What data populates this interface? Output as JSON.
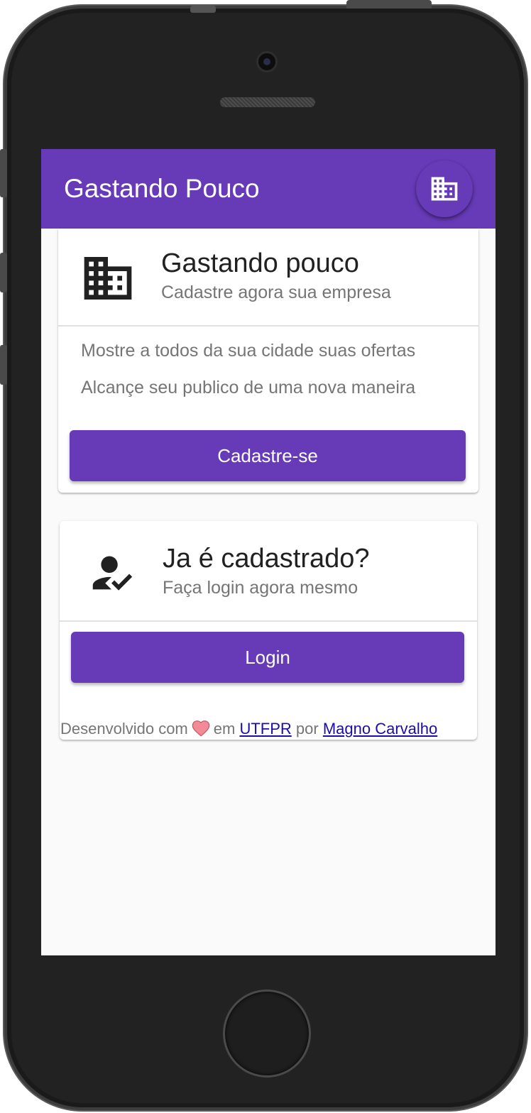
{
  "app": {
    "title": "Gastando Pouco"
  },
  "fab": {
    "icon": "business-icon"
  },
  "register_card": {
    "icon": "business-icon",
    "title": "Gastando pouco",
    "subtitle": "Cadastre agora sua empresa",
    "lines": [
      "Mostre a todos da sua cidade suas ofertas",
      "Alcançe seu publico de uma nova maneira"
    ],
    "button_label": "Cadastre-se"
  },
  "login_card": {
    "icon": "how-to-reg-icon",
    "title": "Ja é cadastrado?",
    "subtitle": "Faça login agora mesmo",
    "button_label": "Login"
  },
  "footer": {
    "prefix": "Desenvolvido com",
    "heart_icon": "heart-icon",
    "middle": "em",
    "link1": "UTFPR",
    "joiner": "por",
    "link2": "Magno Carvalho"
  },
  "colors": {
    "primary": "#673ab7",
    "background": "#fafafa",
    "text_primary": "#212121",
    "text_secondary": "#757575",
    "link": "#1a0dab"
  }
}
